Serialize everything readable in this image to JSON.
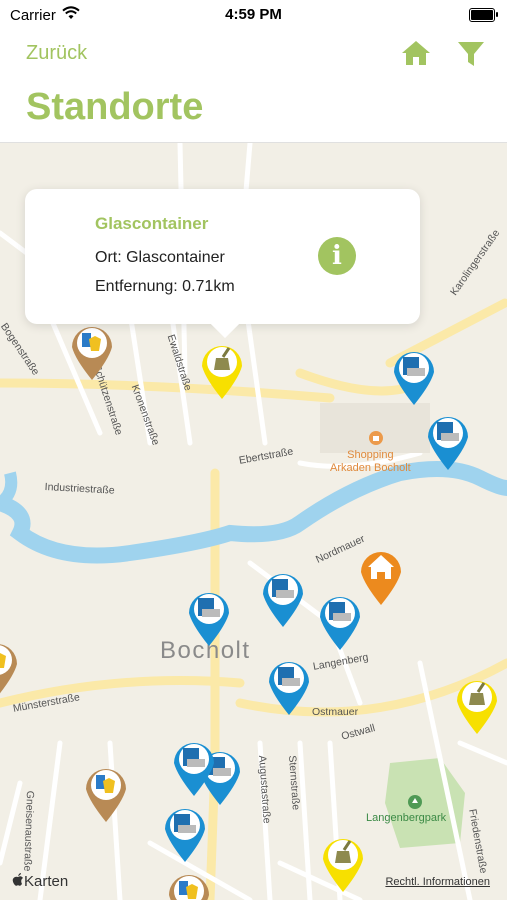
{
  "status": {
    "carrier": "Carrier",
    "time": "4:59 PM"
  },
  "nav": {
    "back": "Zurück",
    "title": "Standorte"
  },
  "callout": {
    "title": "Glascontainer",
    "ort": "Ort: Glascontainer",
    "distance": "Entfernung: 0.71km"
  },
  "map": {
    "city": "Bocholt",
    "poi": "Shopping\nArkaden Bocholt",
    "park": "Langenbergpark",
    "attribution": "Karten",
    "legal": "Rechtl. Informationen",
    "streets": [
      "Karolingerstraße",
      "Bogenstraße",
      "Schützenstraße",
      "Kronenstraße",
      "Ewaldstraße",
      "Ebertstraße",
      "Industriestraße",
      "Münsterstraße",
      "Ostwall",
      "Ostmauer",
      "Augustastraße",
      "Sternstraße",
      "Friedenstraße",
      "Gneisenaustraße",
      "Langenberg",
      "Nordmauer"
    ]
  },
  "colors": {
    "accent": "#a2c460",
    "blue": "#1a8fd2",
    "yellow": "#f7e000",
    "brown": "#b88a55",
    "orange": "#ec8a1e"
  }
}
